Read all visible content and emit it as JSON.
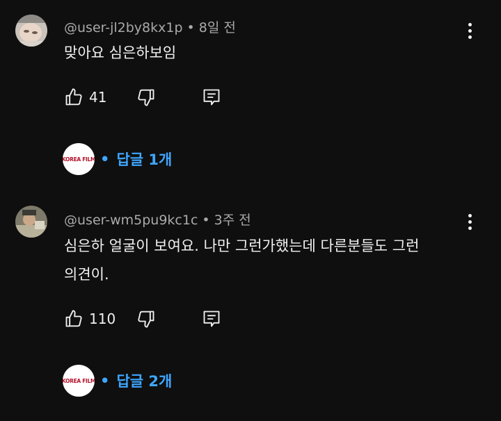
{
  "comments": [
    {
      "username": "@user-jl2by8kx1p",
      "time": "8일 전",
      "text": "맞아요 심은하보임",
      "likes": "41",
      "replies_label": "답글 1개",
      "channel_logo_text": "KOREA FILM"
    },
    {
      "username": "@user-wm5pu9kc1c",
      "time": "3주 전",
      "text_line1": "심은하 얼굴이 보여요. 나만 그런가했는데 다른분들도 그런",
      "text_line2": "의견이.",
      "likes": "110",
      "replies_label": "답글 2개",
      "channel_logo_text": "KOREA FILM"
    }
  ],
  "separator": "•",
  "colors": {
    "background": "#0f0f0f",
    "text": "#f1f1f1",
    "meta": "#aaaaaa",
    "link": "#3ea6ff"
  },
  "icons": [
    "thumbs-up-icon",
    "thumbs-down-icon",
    "reply-icon",
    "more-vert-icon"
  ]
}
